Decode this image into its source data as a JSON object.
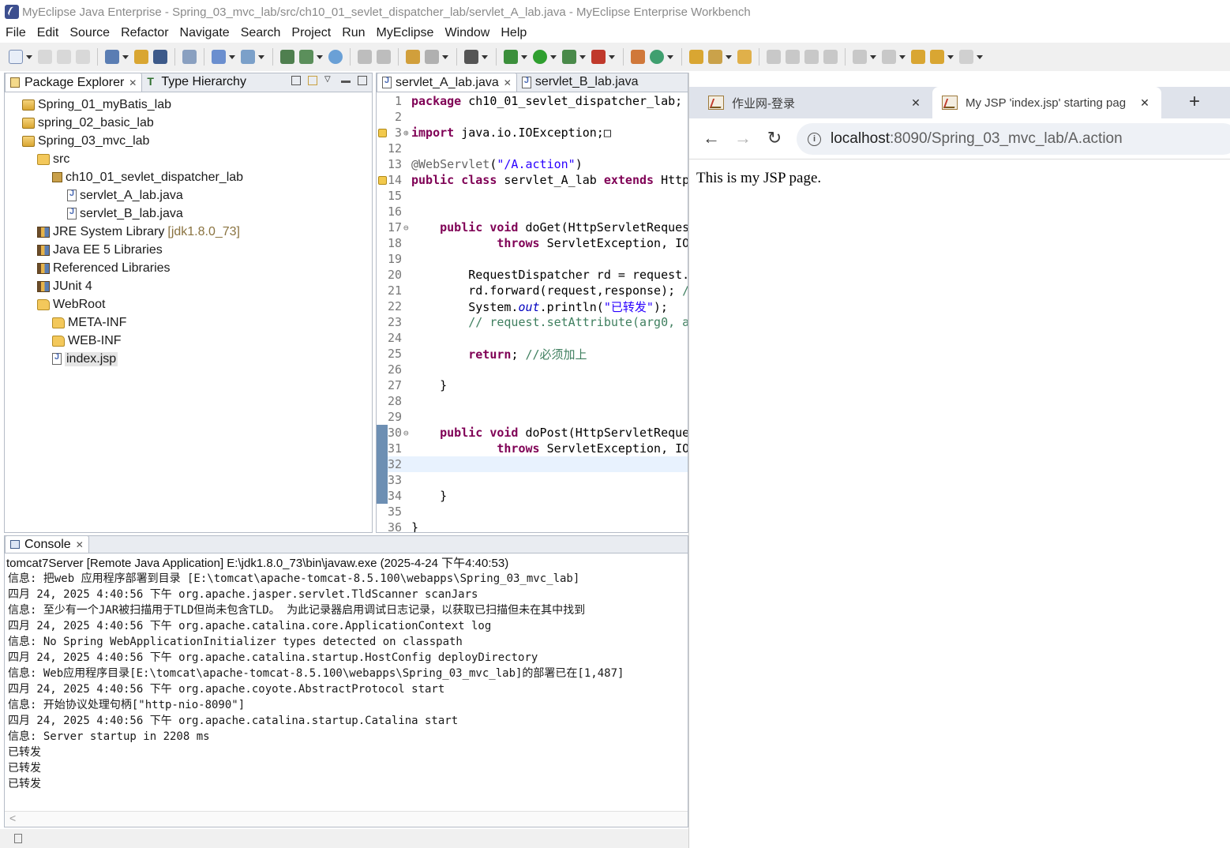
{
  "window": {
    "title": "MyEclipse Java Enterprise - Spring_03_mvc_lab/src/ch10_01_sevlet_dispatcher_lab/servlet_A_lab.java - MyEclipse Enterprise Workbench"
  },
  "menu": [
    "File",
    "Edit",
    "Source",
    "Refactor",
    "Navigate",
    "Search",
    "Project",
    "Run",
    "MyEclipse",
    "Window",
    "Help"
  ],
  "package_explorer": {
    "tabs": [
      {
        "label": "Package Explorer",
        "active": true
      },
      {
        "label": "Type Hierarchy",
        "active": false
      }
    ],
    "tree": [
      {
        "label": "Spring_01_myBatis_lab",
        "icon": "project-icon",
        "depth": 0
      },
      {
        "label": "spring_02_basic_lab",
        "icon": "project-icon",
        "depth": 0
      },
      {
        "label": "Spring_03_mvc_lab",
        "icon": "project-icon",
        "depth": 0
      },
      {
        "label": "src",
        "icon": "source-folder-icon",
        "depth": 1
      },
      {
        "label": "ch10_01_sevlet_dispatcher_lab",
        "icon": "package-icon",
        "depth": 2
      },
      {
        "label": "servlet_A_lab.java",
        "icon": "java-file-icon",
        "depth": 3
      },
      {
        "label": "servlet_B_lab.java",
        "icon": "java-file-icon",
        "depth": 3
      },
      {
        "label": "JRE System Library",
        "suffix": "[jdk1.8.0_73]",
        "icon": "library-icon",
        "depth": 1
      },
      {
        "label": "Java EE 5 Libraries",
        "icon": "library-icon",
        "depth": 1
      },
      {
        "label": "Referenced Libraries",
        "icon": "library-icon",
        "depth": 1
      },
      {
        "label": "JUnit 4",
        "icon": "library-icon",
        "depth": 1
      },
      {
        "label": "WebRoot",
        "icon": "folder-icon",
        "depth": 1
      },
      {
        "label": "META-INF",
        "icon": "folder-icon",
        "depth": 2
      },
      {
        "label": "WEB-INF",
        "icon": "folder-icon",
        "depth": 2
      },
      {
        "label": "index.jsp",
        "icon": "jsp-file-icon",
        "depth": 2,
        "selected": true
      }
    ]
  },
  "editor": {
    "tabs": [
      {
        "label": "servlet_A_lab.java",
        "active": true
      },
      {
        "label": "servlet_B_lab.java",
        "active": false
      }
    ],
    "lines": [
      {
        "n": "1",
        "html": "<span class=\"kw\">package</span> ch10_01_sevlet_dispatcher_lab;"
      },
      {
        "n": "2",
        "html": ""
      },
      {
        "n": "3",
        "html": "<span class=\"kw\">import</span> java.io.IOException;□",
        "fold": "⊕",
        "warn": true
      },
      {
        "n": "12",
        "html": ""
      },
      {
        "n": "13",
        "html": "<span class=\"ann\">@WebServlet</span>(<span class=\"str\">\"/A.action\"</span>)"
      },
      {
        "n": "14",
        "html": "<span class=\"kw\">public class</span> servlet_A_lab <span class=\"kw\">extends</span> HttpServlet",
        "warn": true
      },
      {
        "n": "15",
        "html": ""
      },
      {
        "n": "16",
        "html": ""
      },
      {
        "n": "17",
        "html": "    <span class=\"kw\">public void</span> doGet(HttpServletRequest",
        "fold": "⊖"
      },
      {
        "n": "18",
        "html": "            <span class=\"kw\">throws</span> ServletException, IOException"
      },
      {
        "n": "19",
        "html": ""
      },
      {
        "n": "20",
        "html": "        RequestDispatcher rd = request."
      },
      {
        "n": "21",
        "html": "        rd.forward(request,response); <span class=\"cm\">//</span>"
      },
      {
        "n": "22",
        "html": "        System.<span class=\"ital\">out</span>.println(<span class=\"str\">\"已转发\"</span>);"
      },
      {
        "n": "23",
        "html": "<span class=\"cm\">        // request.setAttribute(arg0, a</span>"
      },
      {
        "n": "24",
        "html": ""
      },
      {
        "n": "25",
        "html": "        <span class=\"kw\">return</span>; <span class=\"cm\">//必须加上</span>"
      },
      {
        "n": "26",
        "html": ""
      },
      {
        "n": "27",
        "html": "    }"
      },
      {
        "n": "28",
        "html": ""
      },
      {
        "n": "29",
        "html": ""
      },
      {
        "n": "30",
        "html": "    <span class=\"kw\">public void</span> doPost(HttpServletReque",
        "fold": "⊖",
        "marked": true
      },
      {
        "n": "31",
        "html": "            <span class=\"kw\">throws</span> ServletException, IO",
        "marked": true
      },
      {
        "n": "32",
        "html": "",
        "current": true,
        "marked": true
      },
      {
        "n": "33",
        "html": "",
        "marked": true
      },
      {
        "n": "34",
        "html": "    }",
        "marked": true
      },
      {
        "n": "35",
        "html": ""
      },
      {
        "n": "36",
        "html": "}"
      }
    ]
  },
  "console": {
    "tab_label": "Console",
    "header": "tomcat7Server [Remote Java Application] E:\\jdk1.8.0_73\\bin\\javaw.exe (2025-4-24 下午4:40:53)",
    "lines": [
      "信息: 把web 应用程序部署到目录 [E:\\tomcat\\apache-tomcat-8.5.100\\webapps\\Spring_03_mvc_lab]",
      "四月 24, 2025 4:40:56 下午 org.apache.jasper.servlet.TldScanner scanJars",
      "信息: 至少有一个JAR被扫描用于TLD但尚未包含TLD。 为此记录器启用调试日志记录，以获取已扫描但未在其中找到",
      "四月 24, 2025 4:40:56 下午 org.apache.catalina.core.ApplicationContext log",
      "信息: No Spring WebApplicationInitializer types detected on classpath",
      "四月 24, 2025 4:40:56 下午 org.apache.catalina.startup.HostConfig deployDirectory",
      "信息: Web应用程序目录[E:\\tomcat\\apache-tomcat-8.5.100\\webapps\\Spring_03_mvc_lab]的部署已在[1,487]",
      "四月 24, 2025 4:40:56 下午 org.apache.coyote.AbstractProtocol start",
      "信息: 开始协议处理句柄[\"http-nio-8090\"]",
      "四月 24, 2025 4:40:56 下午 org.apache.catalina.startup.Catalina start",
      "信息: Server startup in 2208 ms",
      "已转发",
      "已转发",
      "已转发"
    ]
  },
  "browser": {
    "tabs": [
      {
        "title": "作业网-登录",
        "active": false
      },
      {
        "title": "My JSP 'index.jsp' starting pag",
        "active": true
      }
    ],
    "new_tab": "+",
    "url_host": "localhost",
    "url_rest": ":8090/Spring_03_mvc_lab/A.action",
    "content_text": "This is my JSP page."
  },
  "colors": {
    "keyword": "#7f0055",
    "string": "#2a00ff",
    "comment": "#3f7f5f",
    "panel_border": "#b5bcc7",
    "browser_tabstrip": "#dfe3eb"
  }
}
